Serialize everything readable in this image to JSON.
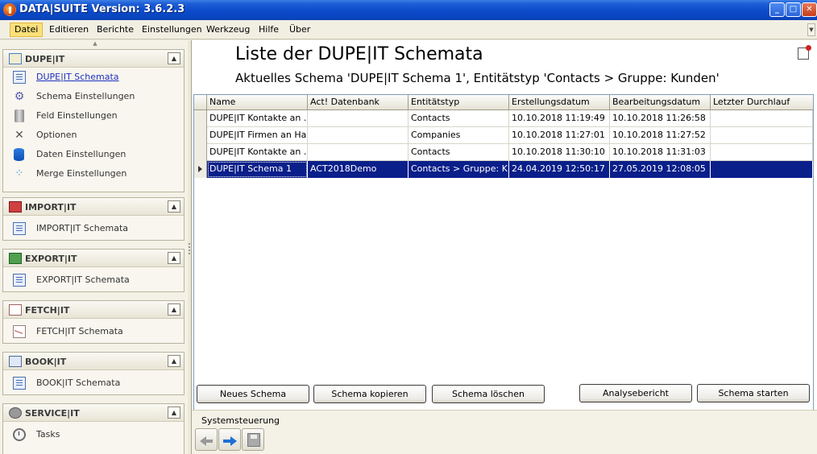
{
  "window": {
    "title": "DATA|SUITE Version: 3.6.2.3",
    "minimize": "_",
    "maximize": "□",
    "close": "✕"
  },
  "menu": [
    "Datei",
    "Editieren",
    "Berichte",
    "Einstellungen",
    "Werkzeug",
    "Hilfe",
    "Über"
  ],
  "sidebar": {
    "dupe": {
      "title": "DUPE|IT",
      "items": [
        {
          "label": "DUPE|IT Schemata",
          "icon": "list-icon"
        },
        {
          "label": "Schema Einstellungen",
          "icon": "gears-icon"
        },
        {
          "label": "Feld Einstellungen",
          "icon": "cylinder-icon"
        },
        {
          "label": "Optionen",
          "icon": "tools-icon"
        },
        {
          "label": "Daten Einstellungen",
          "icon": "database-icon"
        },
        {
          "label": "Merge Einstellungen",
          "icon": "merge-icon"
        }
      ]
    },
    "import": {
      "title": "IMPORT|IT",
      "item": "IMPORT|IT Schemata"
    },
    "export": {
      "title": "EXPORT|IT",
      "item": "EXPORT|IT Schemata"
    },
    "fetch": {
      "title": "FETCH|IT",
      "item": "FETCH|IT Schemata"
    },
    "book": {
      "title": "BOOK|IT",
      "item": "BOOK|IT Schemata"
    },
    "service": {
      "title": "SERVICE|IT",
      "item": "Tasks"
    }
  },
  "main": {
    "title": "Liste der DUPE|IT Schemata",
    "subtitle": "Aktuelles Schema 'DUPE|IT Schema 1', Entitätstyp 'Contacts > Gruppe: Kunden'",
    "columns": [
      "Name",
      "Act! Datenbank",
      "Entitätstyp",
      "Erstellungsdatum",
      "Bearbeitungsdatum",
      "Letzter Durchlauf"
    ],
    "rows": [
      [
        "DUPE|IT Kontakte an ...",
        "",
        "Contacts",
        "10.10.2018 11:19:49",
        "10.10.2018 11:26:58",
        ""
      ],
      [
        "DUPE|IT Firmen an Ha...",
        "",
        "Companies",
        "10.10.2018 11:27:01",
        "10.10.2018 11:27:52",
        ""
      ],
      [
        "DUPE|IT Kontakte an ...",
        "",
        "Contacts",
        "10.10.2018 11:30:10",
        "10.10.2018 11:31:03",
        ""
      ],
      [
        "DUPE|IT Schema 1",
        "ACT2018Demo",
        "Contacts > Gruppe: K...",
        "24.04.2019 12:50:17",
        "27.05.2019 12:08:05",
        ""
      ]
    ],
    "selected_row": 3,
    "buttons": {
      "new": "Neues Schema",
      "copy": "Schema kopieren",
      "delete": "Schema löschen",
      "report": "Analysebericht",
      "start": "Schema starten"
    },
    "system": {
      "label": "Systemsteuerung"
    }
  }
}
